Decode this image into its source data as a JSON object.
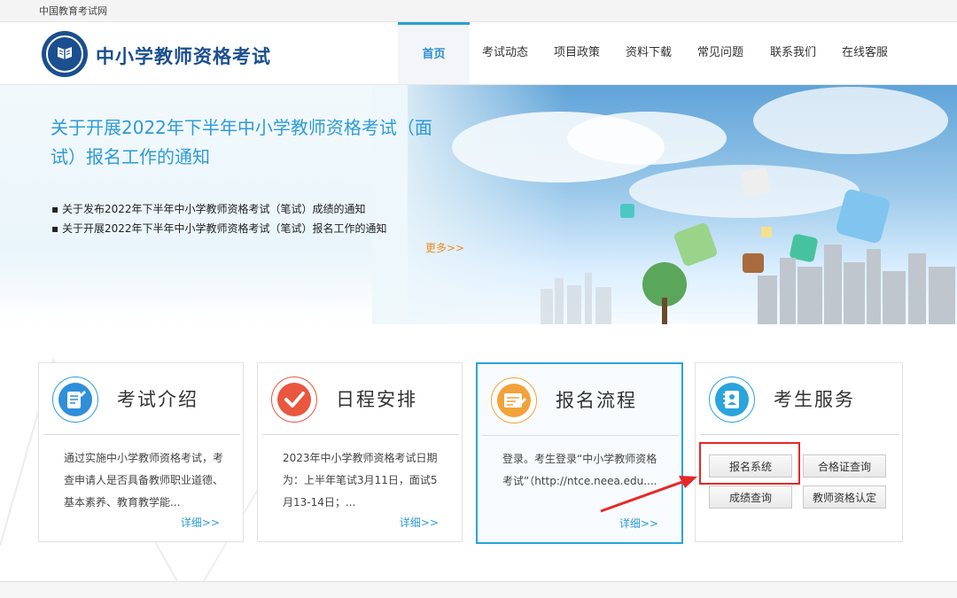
{
  "topbar": {
    "site_name": "中国教育考试网"
  },
  "header": {
    "brand": "中小学教师资格考试"
  },
  "nav": {
    "items": [
      "首页",
      "考试动态",
      "项目政策",
      "资料下载",
      "常见问题",
      "联系我们",
      "在线客服"
    ]
  },
  "banner": {
    "headline": "关于开展2022年下半年中小学教师资格考试（面试）报名工作的通知",
    "news": [
      "关于发布2022年下半年中小学教师资格考试（笔试）成绩的通知",
      "关于开展2022年下半年中小学教师资格考试（笔试）报名工作的通知"
    ],
    "more": "更多>>"
  },
  "cards": [
    {
      "title": "考试介绍",
      "desc": "通过实施中小学教师资格考试，考查申请人是否具备教师职业道德、基本素养、教育教学能...",
      "detail": "详细>>",
      "icon": "document-icon"
    },
    {
      "title": "日程安排",
      "desc": "2023年中小学教师资格考试日期为：上半年笔试3月11日，面试5月13-14日；...",
      "detail": "详细>>",
      "icon": "checkmark-icon"
    },
    {
      "title": "报名流程",
      "desc": "登录。考生登录“中小学教师资格考试”（http://ntce.neea.edu....",
      "detail": "详细>>",
      "icon": "form-icon"
    },
    {
      "title": "考生服务",
      "icon": "contacts-icon"
    }
  ],
  "services": {
    "register": "报名系统",
    "certificate_query": "合格证查询",
    "score_query": "成绩查询",
    "teacher_cert": "教师资格认定"
  },
  "colors": {
    "accent": "#2a9fd6",
    "brand": "#1b4f8f",
    "more": "#f18a1f",
    "highlight_box": "#e62828",
    "annotation_arrow": "#e62828"
  }
}
